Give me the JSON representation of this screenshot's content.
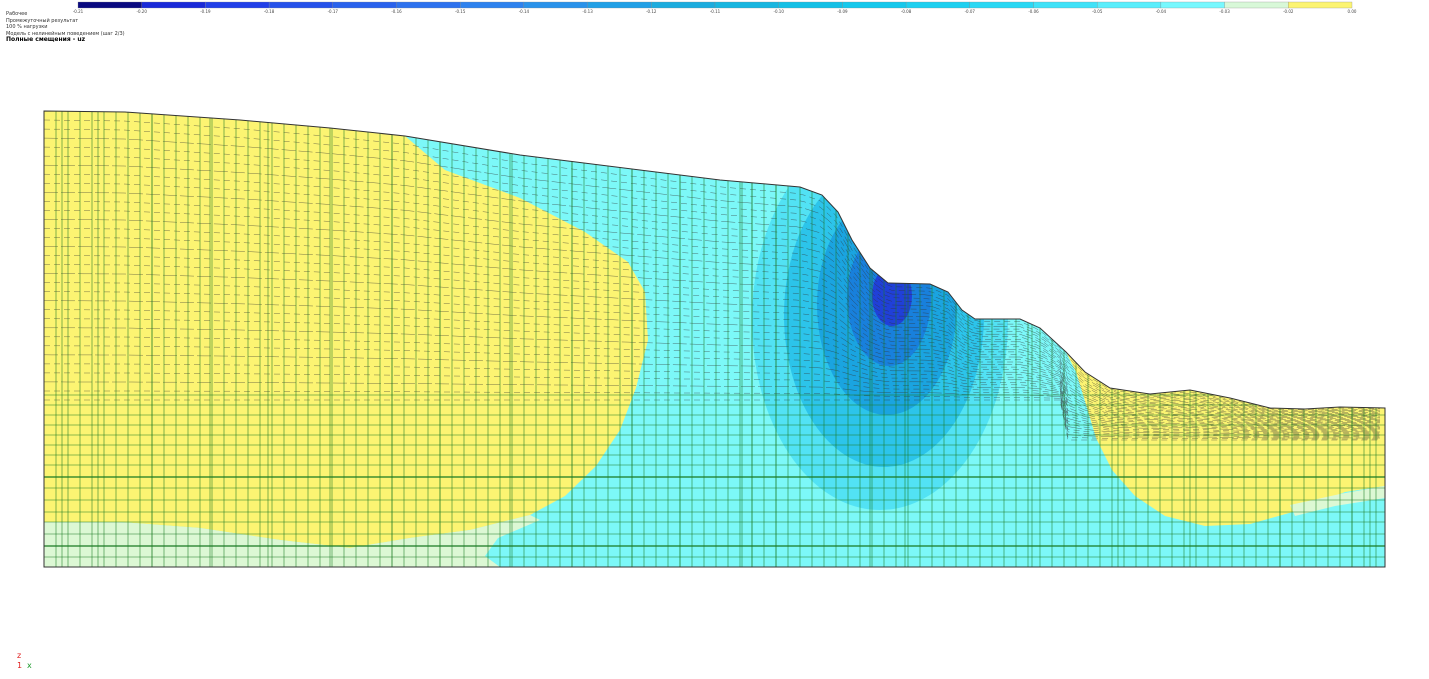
{
  "legend": {
    "colors": [
      "#0a0a80",
      "#1a2ad8",
      "#2240e8",
      "#2652ea",
      "#2a62ec",
      "#2e72ee",
      "#2e82ee",
      "#2a92ea",
      "#22a0e6",
      "#1cacde",
      "#18b6e0",
      "#14c0e6",
      "#16c8ec",
      "#1ed0f0",
      "#2ad8f4",
      "#40e2f8",
      "#5aeefc",
      "#78f8fe",
      "#d8f8d8",
      "#fcf472"
    ],
    "ticks": [
      "-0.21",
      "-0.20",
      "-0.19",
      "-0.18",
      "-0.17",
      "-0.16",
      "-0.15",
      "-0.14",
      "-0.13",
      "-0.12",
      "-0.11",
      "-0.10",
      "-0.09",
      "-0.08",
      "-0.07",
      "-0.06",
      "-0.05",
      "-0.04",
      "-0.03",
      "-0.02",
      "0.00"
    ]
  },
  "caption": {
    "lines": [
      "Рабочее",
      "Промежуточный результат",
      "100 % нагрузки",
      "Модель с нелинейным поведением (шаг 2/3)",
      "Полные смещения - uz"
    ]
  },
  "axes": {
    "vertical": "z",
    "horizontal": "x",
    "origin": "1"
  },
  "contour": {
    "colors": {
      "yellow": "#fcf472",
      "pale": "#dcf8d4",
      "cyan": "#7cf8f8",
      "sky": "#52e2f4",
      "mid": "#2cc4ea",
      "deep": "#1aa4e0",
      "deeper": "#1880dc",
      "core": "#2040d8",
      "mesh": "#1a7a22",
      "hatch": "#333333"
    }
  }
}
